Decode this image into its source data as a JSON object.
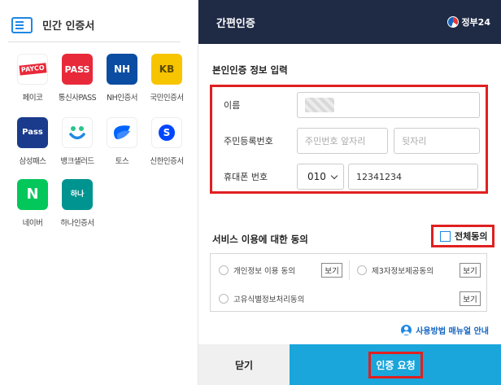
{
  "left": {
    "title": "민간 인증서",
    "certs": [
      {
        "name": "페이코",
        "logo": "PAYCO",
        "color": "#e8293a"
      },
      {
        "name": "통신사PASS",
        "logo": "PASS",
        "color": "#e8293a"
      },
      {
        "name": "NH인증서",
        "logo": "NH",
        "color": "#0a4da2"
      },
      {
        "name": "국민인증서",
        "logo": "KB",
        "color": "#f7c400"
      },
      {
        "name": "삼성패스",
        "logo": "Pass",
        "color": "#1a3b8c"
      },
      {
        "name": "뱅크샐러드",
        "logo": "b",
        "color": "#ffffff"
      },
      {
        "name": "토스",
        "logo": "t",
        "color": "#ffffff"
      },
      {
        "name": "신한인증서",
        "logo": "S",
        "color": "#ffffff"
      },
      {
        "name": "네이버",
        "logo": "N",
        "color": "#03c75a"
      },
      {
        "name": "하나인증서",
        "logo": "하나",
        "color": "#009490"
      }
    ]
  },
  "right": {
    "header_title": "간편인증",
    "gov_label": "정부24",
    "section_title": "본인인증 정보 입력",
    "name_label": "이름",
    "rrn_label": "주민등록번호",
    "rrn_front_placeholder": "주민번호 앞자리",
    "rrn_back_placeholder": "뒷자리",
    "phone_label": "휴대폰 번호",
    "phone_prefix": "010",
    "phone_number": "12341234",
    "consent_title": "서비스 이용에 대한 동의",
    "agree_all": "전체동의",
    "consent_items": [
      "개인정보 이용 동의",
      "제3자정보제공동의",
      "고유식별정보처리동의"
    ],
    "view_label": "보기",
    "manual_label": "사용방법 매뉴얼 안내",
    "close_button": "닫기",
    "request_button": "인증 요청"
  },
  "colors": {
    "header_bg": "#1f2a45",
    "primary": "#1aa5db",
    "highlight": "#e02020"
  }
}
